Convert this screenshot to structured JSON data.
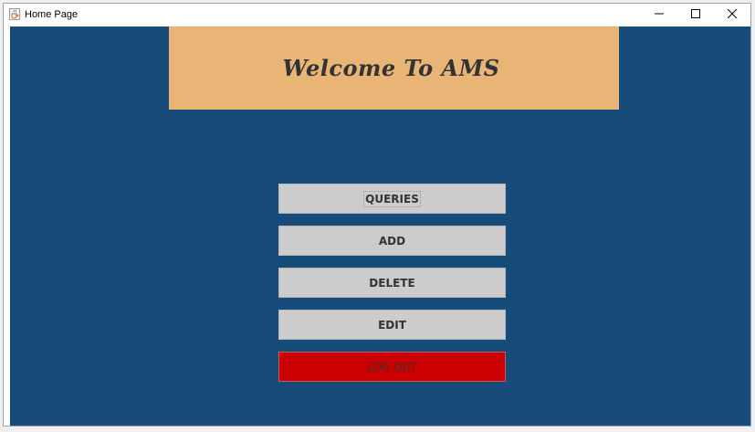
{
  "window": {
    "title": "Home Page",
    "app_icon": "java-coffee-cup-icon",
    "controls": [
      "minimize-icon",
      "maximize-icon",
      "close-icon"
    ]
  },
  "banner": {
    "title": "Welcome To AMS"
  },
  "menu": {
    "queries_label": "QUERIES",
    "add_label": "ADD",
    "delete_label": "DELETE",
    "edit_label": "EDIT",
    "logout_label": "LOG OUT"
  },
  "colors": {
    "background": "#164b7a",
    "banner": "#e9b577",
    "button": "#cccccc",
    "logout_button": "#cc0000",
    "text": "#333333"
  }
}
